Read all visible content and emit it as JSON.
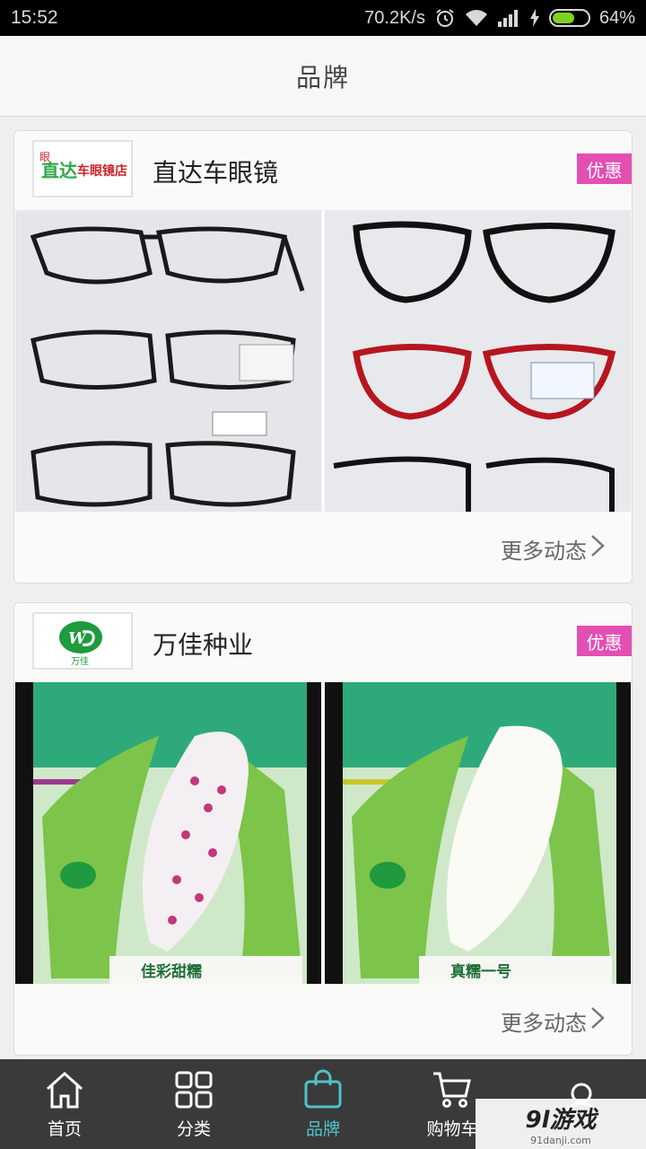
{
  "status_bar": {
    "time": "15:52",
    "speed": "70.2K/s",
    "battery": "64%",
    "battery_level": 0.64
  },
  "header": {
    "title": "品牌"
  },
  "brands": [
    {
      "name": "直达车眼镜",
      "badge": "优惠",
      "logo_text": "直达车眼镜店",
      "more": "更多动态"
    },
    {
      "name": "万佳种业",
      "badge": "优惠",
      "logo_text": "万佳",
      "more": "更多动态"
    }
  ],
  "corn_labels": [
    "佳彩甜糯",
    "真糯一号"
  ],
  "tabs": [
    {
      "label": "首页",
      "icon": "home-icon"
    },
    {
      "label": "分类",
      "icon": "grid-icon"
    },
    {
      "label": "品牌",
      "icon": "bag-icon",
      "active": true
    },
    {
      "label": "购物车",
      "icon": "cart-icon"
    },
    {
      "label": "",
      "icon": "user-icon"
    }
  ],
  "watermark": {
    "main": "9l游戏",
    "sub": "91danji.com"
  },
  "colors": {
    "accent": "#4fc3c8",
    "badge": "#e34fb3",
    "tabbar": "#3a3a3a"
  }
}
